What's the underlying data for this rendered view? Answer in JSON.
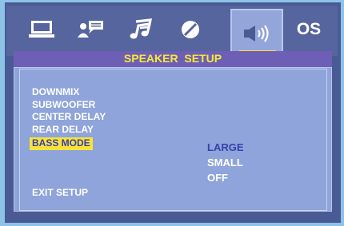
{
  "tabs": [
    {
      "icon": "monitor-icon",
      "active": false
    },
    {
      "icon": "audio-speaking-icon",
      "active": false
    },
    {
      "icon": "music-note-icon",
      "active": false
    },
    {
      "icon": "disc-icon",
      "active": false
    },
    {
      "icon": "speaker-icon",
      "active": true
    },
    {
      "icon": "os-label",
      "label": "OS",
      "active": false
    }
  ],
  "title": "SPEAKER  SETUP",
  "menu": {
    "items": [
      "DOWNMIX",
      "SUBWOOFER",
      "CENTER DELAY",
      "REAR DELAY",
      "BASS MODE"
    ],
    "selected": "BASS MODE",
    "exit_label": "EXIT SETUP"
  },
  "options": {
    "items": [
      "LARGE",
      "SMALL",
      "OFF"
    ],
    "selected": "LARGE"
  },
  "colors": {
    "background": "#8ec3e8",
    "frame": "#4a5a94",
    "title_bar": "#6e5fb6",
    "title_text": "#f6ea32",
    "panel": "#8ea4da",
    "highlight": "#f6e33a",
    "selected_text": "#3a3fae"
  }
}
